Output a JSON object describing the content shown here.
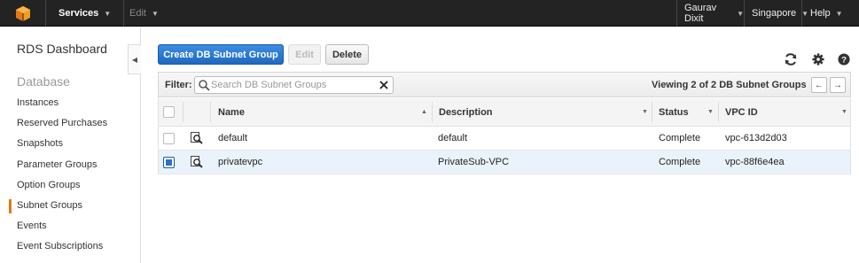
{
  "topnav": {
    "services_label": "Services",
    "edit_label": "Edit",
    "user_label": "Gaurav Dixit",
    "region_label": "Singapore",
    "help_label": "Help"
  },
  "sidebar": {
    "title": "RDS Dashboard",
    "section_label": "Database",
    "items": [
      {
        "label": "Instances"
      },
      {
        "label": "Reserved Purchases"
      },
      {
        "label": "Snapshots"
      },
      {
        "label": "Parameter Groups"
      },
      {
        "label": "Option Groups"
      },
      {
        "label": "Subnet Groups",
        "active": true
      },
      {
        "label": "Events"
      },
      {
        "label": "Event Subscriptions"
      }
    ]
  },
  "toolbar": {
    "create_label": "Create DB Subnet Group",
    "edit_label": "Edit",
    "delete_label": "Delete"
  },
  "filter": {
    "label": "Filter:",
    "placeholder": "Search DB Subnet Groups",
    "value": "",
    "viewing_text": "Viewing 2 of 2 DB Subnet Groups"
  },
  "table": {
    "columns": [
      "Name",
      "Description",
      "Status",
      "VPC ID"
    ],
    "rows": [
      {
        "name": "default",
        "description": "default",
        "status": "Complete",
        "vpc_id": "vpc-613d2d03",
        "selected": false
      },
      {
        "name": "privatevpc",
        "description": "PrivateSub-VPC",
        "status": "Complete",
        "vpc_id": "vpc-88f6e4ea",
        "selected": true
      }
    ]
  },
  "colors": {
    "accent": "#e47911",
    "primary_button": "#2a72c7",
    "nav_bg": "#232323",
    "selected_row": "#eaf3fb"
  },
  "icons": {
    "logo": "aws-cube-icon",
    "refresh": "refresh-icon",
    "settings": "gear-icon",
    "help": "help-icon",
    "search": "search-icon",
    "clear": "close-icon",
    "row_details": "magnifier-details-icon"
  }
}
